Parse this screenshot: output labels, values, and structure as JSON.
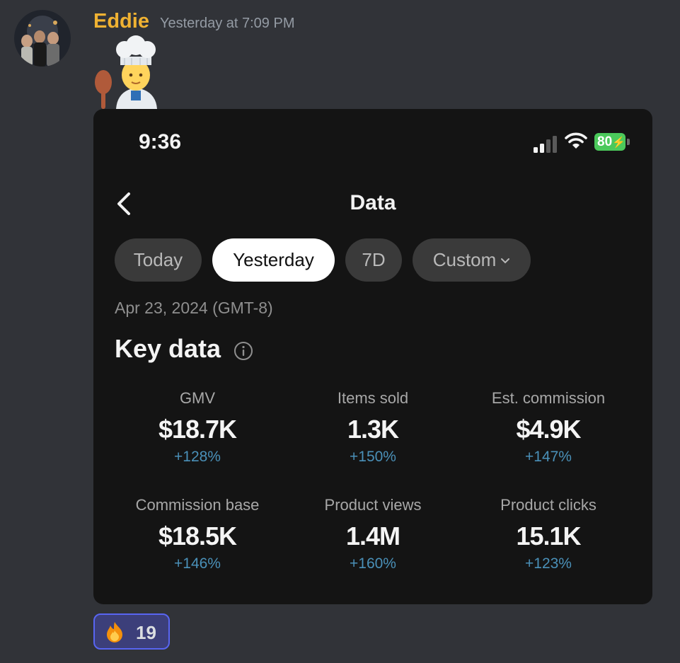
{
  "message": {
    "username": "Eddie",
    "timestamp": "Yesterday at 7:09 PM",
    "emoji": "cook-emoji",
    "reaction": {
      "emoji": "fire-icon",
      "count": "19"
    }
  },
  "screenshot": {
    "status_bar": {
      "time": "9:36",
      "battery": "80"
    },
    "nav": {
      "title": "Data"
    },
    "tabs": [
      {
        "label": "Today",
        "active": false
      },
      {
        "label": "Yesterday",
        "active": true
      },
      {
        "label": "7D",
        "active": false
      },
      {
        "label": "Custom",
        "active": false
      }
    ],
    "date": "Apr 23, 2024 (GMT-8)",
    "section_title": "Key data",
    "metrics": [
      {
        "label": "GMV",
        "value": "$18.7K",
        "delta": "+128%"
      },
      {
        "label": "Items sold",
        "value": "1.3K",
        "delta": "+150%"
      },
      {
        "label": "Est. commission",
        "value": "$4.9K",
        "delta": "+147%"
      },
      {
        "label": "Commission base",
        "value": "$18.5K",
        "delta": "+146%"
      },
      {
        "label": "Product views",
        "value": "1.4M",
        "delta": "+160%"
      },
      {
        "label": "Product clicks",
        "value": "15.1K",
        "delta": "+123%"
      }
    ]
  },
  "colors": {
    "background": "#313338",
    "username": "#f0b232",
    "card": "#141414",
    "delta": "#4a90b8",
    "battery": "#4bc95b",
    "reaction_border": "#5865f2"
  }
}
